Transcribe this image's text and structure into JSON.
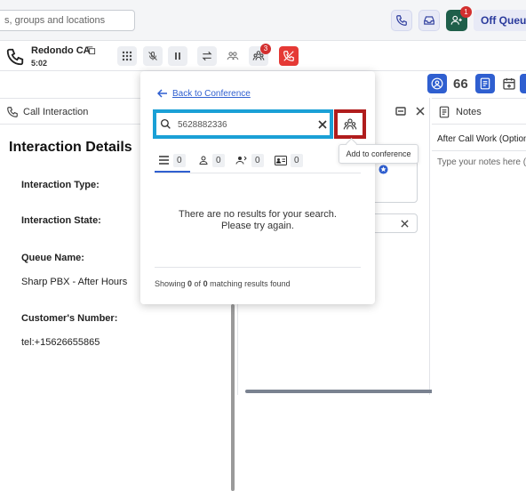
{
  "topbar": {
    "search_placeholder": "s, groups and locations",
    "agent_badge_count": "1",
    "status_label": "Off Queue"
  },
  "callbar": {
    "caller_name": "Redondo CA",
    "duration": "5:02",
    "conference_badge_count": "3"
  },
  "toolbar": {
    "count": "66"
  },
  "left_panel": {
    "header": "Call Interaction",
    "title": "Interaction Details",
    "fields": [
      {
        "label": "Interaction Type:",
        "value": ""
      },
      {
        "label": "Interaction State:",
        "value": ""
      },
      {
        "label": "Queue Name:",
        "value": "Sharp PBX - After Hours"
      },
      {
        "label": "Customer's Number:",
        "value": "tel:+15626655865"
      }
    ]
  },
  "notes_panel": {
    "title": "Notes",
    "acw_label": "After Call Work (Optional",
    "placeholder": "Type your notes here (no"
  },
  "popup": {
    "back_label": "Back to Conference",
    "search_value": "5628882336",
    "tabs": [
      {
        "icon": "list-icon",
        "count": "0"
      },
      {
        "icon": "person-icon",
        "count": "0"
      },
      {
        "icon": "group-icon",
        "count": "0"
      },
      {
        "icon": "contact-card-icon",
        "count": "0"
      }
    ],
    "no_results_line1": "There are no results for your search.",
    "no_results_line2": "Please try again.",
    "match_prefix": "Showing ",
    "match_shown": "0",
    "match_of": " of ",
    "match_total": "0",
    "match_suffix": " matching results found"
  },
  "tooltip": {
    "text": "Add to conference"
  },
  "colors": {
    "accent": "#2f5fd0",
    "search_highlight": "#1aa0d6",
    "button_highlight": "#b01c1c",
    "hangup": "#e53935"
  }
}
